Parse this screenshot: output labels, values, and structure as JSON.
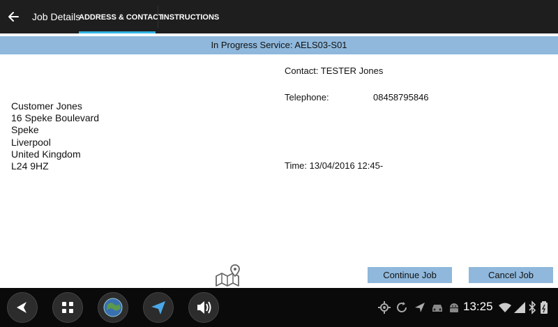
{
  "header": {
    "title": "Job Details",
    "tabs": [
      {
        "label": "ADDRESS & CONTACT",
        "active": true
      },
      {
        "label": "INSTRUCTIONS",
        "active": false
      }
    ]
  },
  "banner": {
    "text": "In Progress Service: AELS03-S01"
  },
  "address": {
    "lines": [
      "Customer Jones",
      "16 Speke Boulevard",
      "Speke",
      "Liverpool",
      "United Kingdom",
      "L24 9HZ"
    ]
  },
  "contact": {
    "contact_text": "Contact: TESTER Jones",
    "telephone_label": "Telephone:",
    "telephone_value": "08458795846",
    "time_text": "Time: 13/04/2016 12:45-"
  },
  "actions": {
    "continue_label": "Continue Job",
    "cancel_label": "Cancel Job"
  },
  "system_bar": {
    "clock": "13:25",
    "nav_icons": [
      "back-icon",
      "apps-grid-icon",
      "globe-icon",
      "navigation-arrow-icon",
      "volume-icon"
    ],
    "status_icons": [
      "gps-icon",
      "sync-icon",
      "location-arrow-icon",
      "car-icon",
      "android-icon",
      "wifi-icon",
      "signal-icon",
      "bluetooth-icon",
      "battery-icon"
    ]
  },
  "colors": {
    "appbar_bg": "#1e1e1e",
    "tab_indicator": "#33b5e5",
    "banner_bg": "#8fb8dc",
    "button_bg": "#8fb8dc",
    "navbar_bg": "#0a0a0a"
  }
}
